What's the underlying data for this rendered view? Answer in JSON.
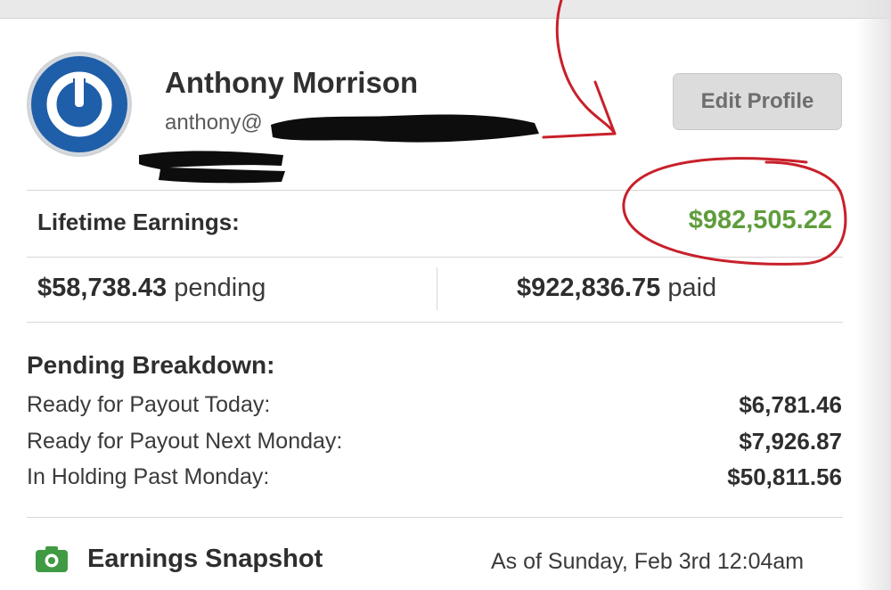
{
  "profile": {
    "name": "Anthony Morrison",
    "email_visible": "anthony@",
    "edit_button_label": "Edit Profile"
  },
  "earnings": {
    "lifetime_label": "Lifetime Earnings:",
    "lifetime_value": "$982,505.22",
    "pending_amount": "$58,738.43",
    "pending_suffix": " pending",
    "paid_amount": "$922,836.75",
    "paid_suffix": " paid"
  },
  "breakdown": {
    "title": "Pending Breakdown:",
    "rows": [
      {
        "label": "Ready for Payout Today:",
        "value": "$6,781.46"
      },
      {
        "label": "Ready for Payout Next Monday:",
        "value": "$7,926.87"
      },
      {
        "label": "In Holding Past Monday:",
        "value": "$50,811.56"
      }
    ]
  },
  "snapshot": {
    "title": "Earnings Snapshot",
    "as_of": "As of Sunday, Feb 3rd 12:04am",
    "icon": "camera-icon"
  },
  "colors": {
    "lifetime_green": "#5f9d3c",
    "avatar_blue": "#1f5ea8",
    "annotation_red": "#c8202a",
    "snapshot_icon_green": "#3f9a43"
  },
  "icons": {
    "avatar": "power-logo-icon",
    "snapshot": "camera-icon"
  }
}
